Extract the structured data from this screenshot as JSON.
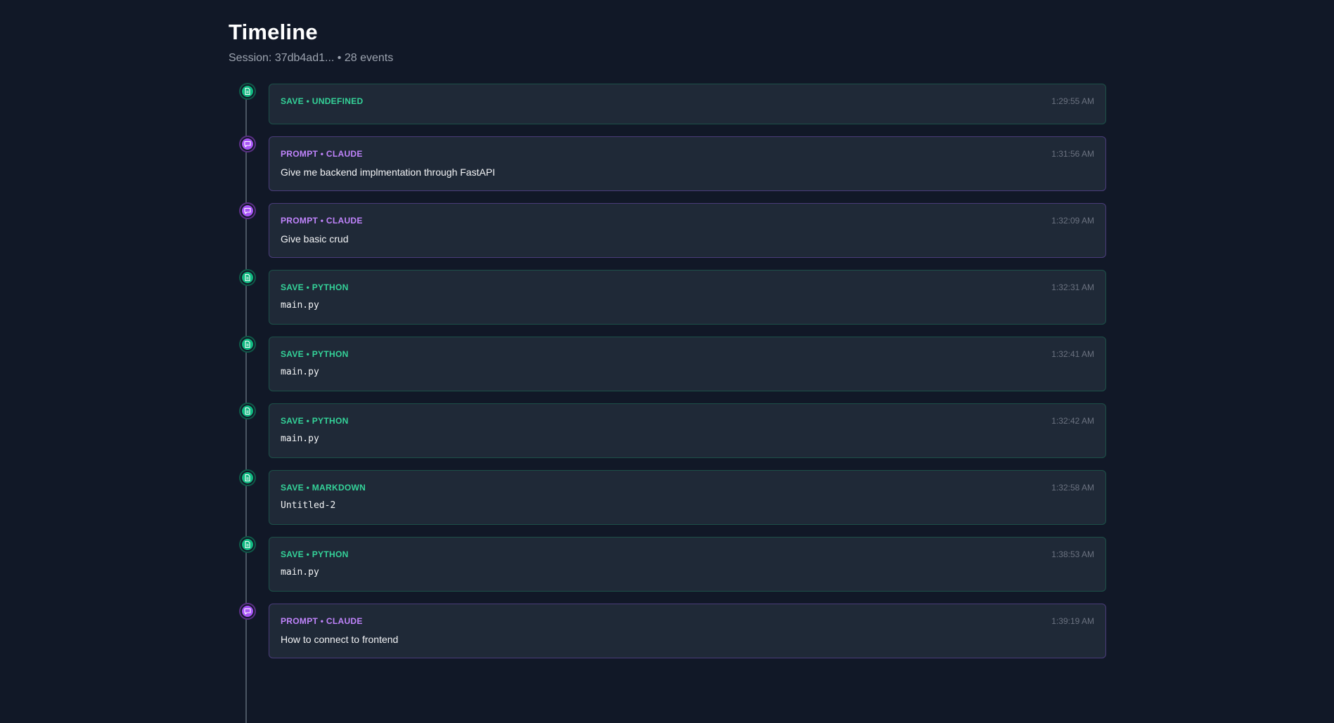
{
  "header": {
    "title": "Timeline",
    "subtitle": "Session: 37db4ad1... • 28 events"
  },
  "colors": {
    "save": "#34d399",
    "prompt": "#c084fc",
    "background": "#111827",
    "card": "#1f2937"
  },
  "icons": {
    "save": "file-icon",
    "prompt": "chat-bubble-icon"
  },
  "events": [
    {
      "type": "save",
      "kind": "SAVE • UNDEFINED",
      "time": "1:29:55 AM",
      "body": ""
    },
    {
      "type": "prompt",
      "kind": "PROMPT • CLAUDE",
      "time": "1:31:56 AM",
      "body": "Give me backend implmentation through FastAPI"
    },
    {
      "type": "prompt",
      "kind": "PROMPT • CLAUDE",
      "time": "1:32:09 AM",
      "body": "Give basic crud"
    },
    {
      "type": "save",
      "kind": "SAVE • PYTHON",
      "time": "1:32:31 AM",
      "body": "main.py"
    },
    {
      "type": "save",
      "kind": "SAVE • PYTHON",
      "time": "1:32:41 AM",
      "body": "main.py"
    },
    {
      "type": "save",
      "kind": "SAVE • PYTHON",
      "time": "1:32:42 AM",
      "body": "main.py"
    },
    {
      "type": "save",
      "kind": "SAVE • MARKDOWN",
      "time": "1:32:58 AM",
      "body": "Untitled-2"
    },
    {
      "type": "save",
      "kind": "SAVE • PYTHON",
      "time": "1:38:53 AM",
      "body": "main.py"
    },
    {
      "type": "prompt",
      "kind": "PROMPT • CLAUDE",
      "time": "1:39:19 AM",
      "body": "How to connect to frontend"
    }
  ]
}
